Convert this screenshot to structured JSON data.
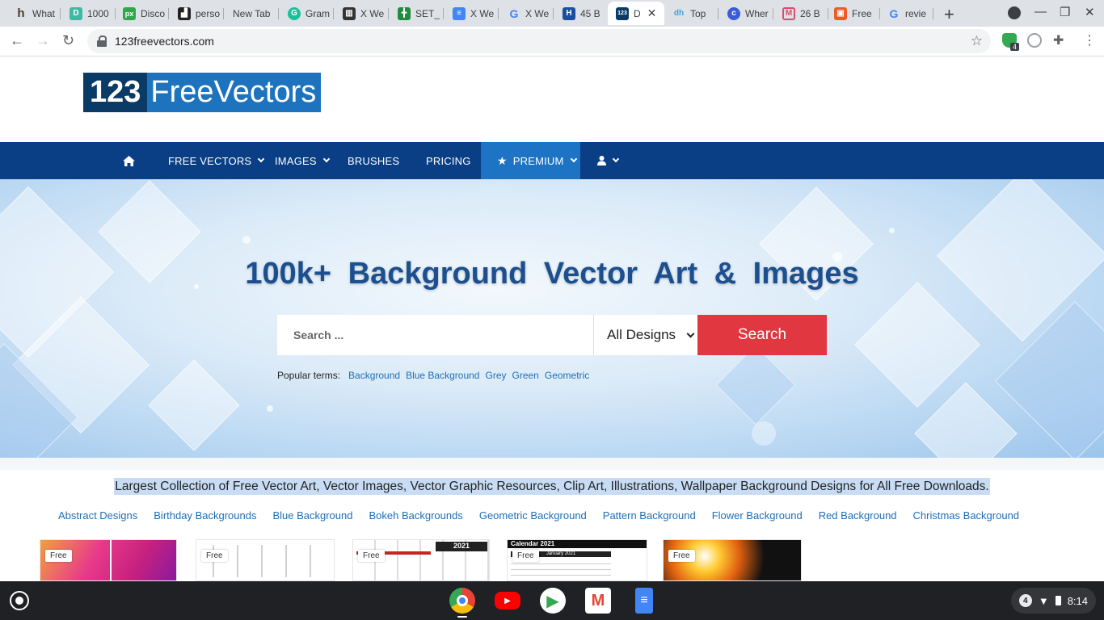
{
  "browser": {
    "tabs": [
      {
        "title": "What",
        "icon": "houzz-icon",
        "color": "#4a3b2b"
      },
      {
        "title": "1000",
        "icon": "d-icon",
        "color": "#3fb8a4"
      },
      {
        "title": "Disco",
        "icon": "px-icon",
        "color": "#2ea84a"
      },
      {
        "title": "perso",
        "icon": "pixel-icon",
        "color": "#222222"
      },
      {
        "title": "New Tab",
        "icon": "",
        "color": ""
      },
      {
        "title": "Gram",
        "icon": "grammarly-icon",
        "color": "#15c39a"
      },
      {
        "title": "X We",
        "icon": "bar-icon",
        "color": "#333333"
      },
      {
        "title": "SET_",
        "icon": "sheets-icon",
        "color": "#1e8e3e"
      },
      {
        "title": "X We",
        "icon": "docs-icon",
        "color": "#4285f4"
      },
      {
        "title": "X We",
        "icon": "google-icon",
        "color": "#4285f4"
      },
      {
        "title": "45 B",
        "icon": "h-icon",
        "color": "#1a4fa0"
      },
      {
        "title": "D",
        "icon": "123-icon",
        "color": "#0a3a66",
        "active": true
      },
      {
        "title": "Top",
        "icon": "dh-icon",
        "color": "#3aa3e3"
      },
      {
        "title": "Wher",
        "icon": "c-icon",
        "color": "#3b5cd9"
      },
      {
        "title": "26 B",
        "icon": "m-icon",
        "color": "#e04a6a"
      },
      {
        "title": "Free",
        "icon": "pp-icon",
        "color": "#f05a28"
      },
      {
        "title": "revie",
        "icon": "google-icon",
        "color": "#4285f4"
      }
    ],
    "url": "123freevectors.com",
    "extension_badge": "4"
  },
  "site": {
    "logo_num": "123",
    "logo_word": "FreeVectors",
    "nav": {
      "free_vectors": "FREE VECTORS",
      "images": "IMAGES",
      "brushes": "BRUSHES",
      "pricing": "PRICING",
      "premium": "PREMIUM"
    },
    "hero": {
      "title": "100k+ Background Vector Art & Images",
      "search_placeholder": "Search ...",
      "select_value": "All Designs",
      "search_button": "Search",
      "popular_label": "Popular terms:",
      "popular_terms": [
        "Background",
        "Blue Background",
        "Grey",
        "Green",
        "Geometric"
      ]
    },
    "tagline": "Largest Collection of Free Vector Art, Vector Images, Vector Graphic Resources, Clip Art, Illustrations, Wallpaper Background Designs for All Free Downloads.",
    "categories": [
      "Abstract Designs",
      "Birthday Backgrounds",
      "Blue Background",
      "Bokeh Backgrounds",
      "Geometric Background",
      "Pattern Background",
      "Flower Background",
      "Red Background",
      "Christmas Background"
    ],
    "thumbnails": [
      {
        "badge": "Free"
      },
      {
        "badge": "Free"
      },
      {
        "badge": "Free",
        "text": "2021"
      },
      {
        "badge": "Free",
        "text": "Calendar 2021",
        "subtext": "January 2021"
      },
      {
        "badge": "Free"
      }
    ]
  },
  "shelf": {
    "apps": [
      "chrome-icon",
      "youtube-icon",
      "play-store-icon",
      "gmail-icon",
      "docs-icon"
    ],
    "notification_count": "4",
    "time": "8:14"
  }
}
